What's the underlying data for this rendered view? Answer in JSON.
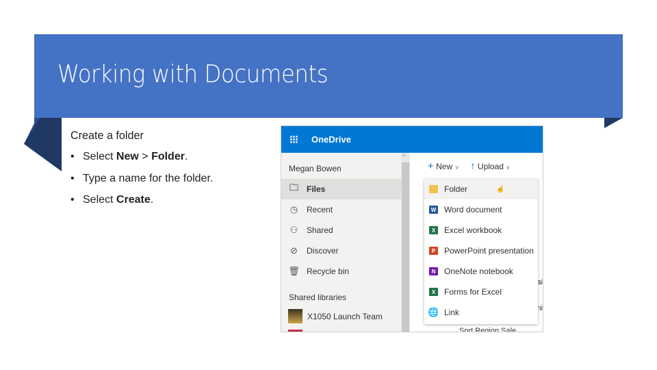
{
  "slide": {
    "title": "Working with Documents",
    "heading": "Create a folder",
    "bullets": [
      {
        "pre": "Select ",
        "bold": "New",
        "mid": " > ",
        "bold2": "Folder",
        "post": "."
      },
      {
        "pre": "Type a name for the folder.",
        "bold": "",
        "mid": "",
        "bold2": "",
        "post": ""
      },
      {
        "pre": "Select ",
        "bold": "Create",
        "mid": "",
        "bold2": "",
        "post": "."
      }
    ],
    "accent": "#4472C4"
  },
  "onedrive": {
    "app_title": "OneDrive",
    "user": "Megan Bowen",
    "nav": [
      {
        "label": "Files",
        "icon": "folder-icon"
      },
      {
        "label": "Recent",
        "icon": "clock-icon"
      },
      {
        "label": "Shared",
        "icon": "people-icon"
      },
      {
        "label": "Discover",
        "icon": "compass-icon"
      },
      {
        "label": "Recycle bin",
        "icon": "trash-icon"
      }
    ],
    "shared_libraries_header": "Shared libraries",
    "library": "X1050 Launch Team",
    "commands": {
      "new": "New",
      "upload": "Upload"
    },
    "new_menu": [
      {
        "label": "Folder",
        "icon": "folder-icon",
        "color": "#F2C14E"
      },
      {
        "label": "Word document",
        "icon": "word-icon",
        "color": "#2B579A"
      },
      {
        "label": "Excel workbook",
        "icon": "excel-icon",
        "color": "#217346"
      },
      {
        "label": "PowerPoint presentation",
        "icon": "powerpoint-icon",
        "color": "#D24726"
      },
      {
        "label": "OneNote notebook",
        "icon": "onenote-icon",
        "color": "#7719AA"
      },
      {
        "label": "Forms for Excel",
        "icon": "forms-excel-icon",
        "color": "#217346"
      },
      {
        "label": "Link",
        "icon": "globe-icon",
        "color": "#0078D4"
      }
    ],
    "bg_text": {
      "r1": "ai",
      "r2": "ni",
      "r3": "Sort Region Sale"
    },
    "brand": "#0078D4"
  }
}
